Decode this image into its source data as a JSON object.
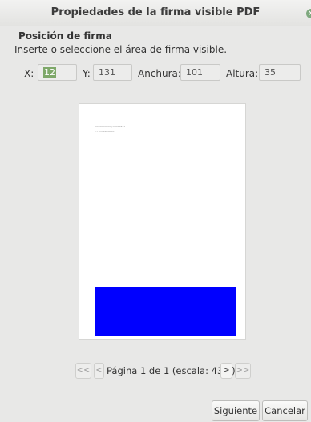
{
  "dialog": {
    "title": "Propiedades de la firma visible PDF",
    "close_glyph": "×"
  },
  "position": {
    "section_title": "Posición de firma",
    "instructions": "Inserte o seleccione el área de firma visible.",
    "fields": {
      "x_label": "X:",
      "x_value": "12",
      "y_label": "Y:",
      "y_value": "131",
      "width_label": "Anchura:",
      "width_value": "101",
      "height_label": "Altura:",
      "height_value": "35"
    }
  },
  "preview": {
    "document_lines": [
      "0000000000  p0777787d",
      "775554eqN0007"
    ],
    "signature_area_color": "#0000ff"
  },
  "pager": {
    "first": "<<",
    "prev": "<",
    "label": "Página 1 de 1 (escala: 43%)",
    "next": ">",
    "last": ">>"
  },
  "actions": {
    "next_label": "Siguiente",
    "cancel_label": "Cancelar"
  }
}
